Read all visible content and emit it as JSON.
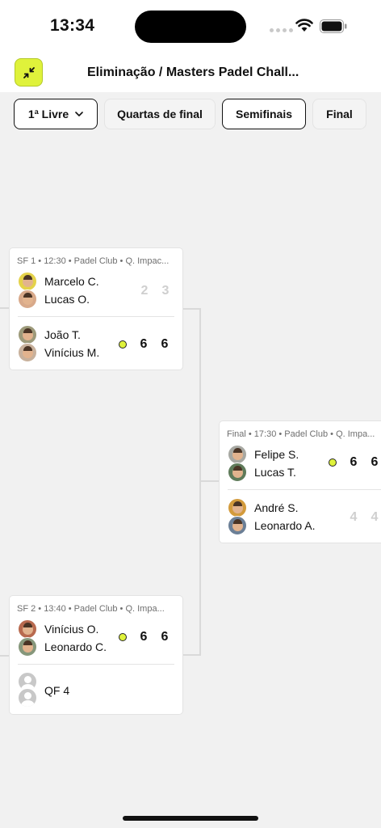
{
  "status_bar": {
    "time": "13:34"
  },
  "header": {
    "title": "Eliminação / Masters Padel Chall..."
  },
  "tabs": [
    {
      "label": "1ª Livre",
      "active": true
    },
    {
      "label": "Quartas de final",
      "active": false
    },
    {
      "label": "Semifinais",
      "active": true
    },
    {
      "label": "Final",
      "active": false
    }
  ],
  "matches": [
    {
      "meta": "SF 1 • 12:30 • Padel Club • Q. Impac...",
      "teams": [
        {
          "players": [
            "Marcelo C.",
            "Lucas O."
          ],
          "scores": [
            "2",
            "3"
          ],
          "winner": false
        },
        {
          "players": [
            "João T.",
            "Vinícius M."
          ],
          "scores": [
            "6",
            "6"
          ],
          "winner": true
        }
      ]
    },
    {
      "meta": "SF 2 • 13:40 • Padel Club • Q. Impa...",
      "teams": [
        {
          "players": [
            "Vinícius O.",
            "Leonardo C."
          ],
          "scores": [
            "6",
            "6"
          ],
          "winner": true
        },
        {
          "players": [
            "QF 4"
          ],
          "scores": [],
          "winner": false
        }
      ]
    },
    {
      "meta": "Final • 17:30 • Padel Club • Q. Impa...",
      "teams": [
        {
          "players": [
            "Felipe S.",
            "Lucas T."
          ],
          "scores": [
            "6",
            "6"
          ],
          "winner": true
        },
        {
          "players": [
            "André S.",
            "Leonardo A."
          ],
          "scores": [
            "4",
            "4"
          ],
          "winner": false
        }
      ]
    }
  ],
  "colors": {
    "accent": "#dff23b",
    "loser_score": "#cfcfcf",
    "background": "#f1f1f1"
  },
  "icons": {
    "collapse": "arrows-collapse-icon",
    "placeholder": "person-placeholder-icon"
  }
}
